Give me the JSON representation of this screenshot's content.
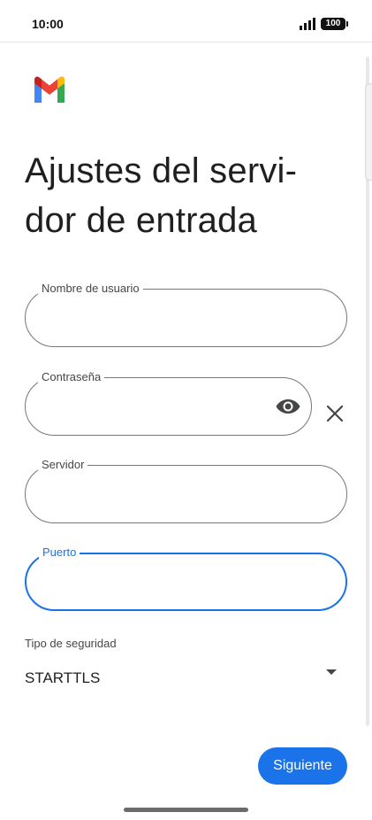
{
  "status_bar": {
    "time": "10:00",
    "battery": "100"
  },
  "page": {
    "title": "Ajustes del servi-dor de entrada"
  },
  "form": {
    "username": {
      "label": "Nombre de usuario",
      "value": ""
    },
    "password": {
      "label": "Contraseña",
      "value": ""
    },
    "server": {
      "label": "Servidor",
      "value": ""
    },
    "port": {
      "label": "Puerto",
      "value": ""
    },
    "security": {
      "label": "Tipo de seguridad",
      "selected": "STARTTLS"
    }
  },
  "actions": {
    "next_label": "Siguiente"
  },
  "icons": {
    "logo": "gmail-logo-icon",
    "eye": "eye-icon",
    "clear": "close-icon",
    "dropdown": "dropdown-arrow-icon"
  },
  "colors": {
    "accent": "#1a73e8",
    "outline": "#747775"
  }
}
